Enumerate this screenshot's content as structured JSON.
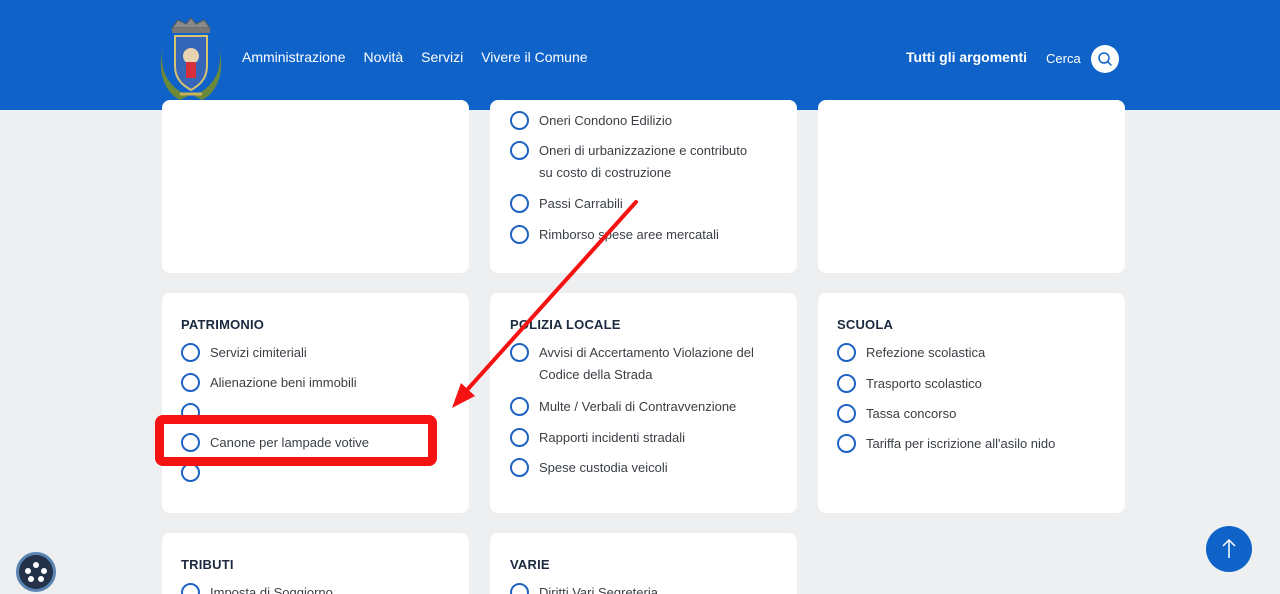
{
  "header": {
    "nav": [
      "Amministrazione",
      "Novità",
      "Servizi",
      "Vivere il Comune"
    ],
    "topics_label": "Tutti gli argomenti",
    "search_label": "Cerca"
  },
  "cards": {
    "top_middle": {
      "items": [
        "Oneri Condono Edilizio",
        "Oneri di urbanizzazione e contributo",
        "su costo di costruzione",
        "Passi Carrabili",
        "Rimborso spese aree mercatali"
      ]
    },
    "patrimonio": {
      "title": "PATRIMONIO",
      "items": [
        "Servizi cimiteriali",
        "Alienazione beni immobili",
        "Canone per lampade votive"
      ]
    },
    "polizia": {
      "title": "POLIZIA LOCALE",
      "items": [
        "Avvisi di Accertamento Violazione del",
        "Codice della Strada",
        "Multe / Verbali di Contravvenzione",
        "Rapporti incidenti stradali",
        "Spese custodia veicoli"
      ]
    },
    "scuola": {
      "title": "SCUOLA",
      "items": [
        "Refezione scolastica",
        "Trasporto scolastico",
        "Tassa concorso",
        "Tariffa per iscrizione all'asilo nido"
      ]
    },
    "tributi": {
      "title": "TRIBUTI",
      "items": [
        "Imposta di Soggiorno"
      ]
    },
    "varie": {
      "title": "VARIE",
      "items": [
        "Diritti Vari Segreteria"
      ]
    }
  },
  "colors": {
    "brand": "#0f63c8",
    "highlight": "#f41212",
    "radio": "#1e63c4"
  },
  "icons": {
    "search": "search-icon",
    "arrow_up": "arrow-up-icon",
    "accessibility": "accessibility-icon",
    "crest": "municipal-crest-icon"
  }
}
